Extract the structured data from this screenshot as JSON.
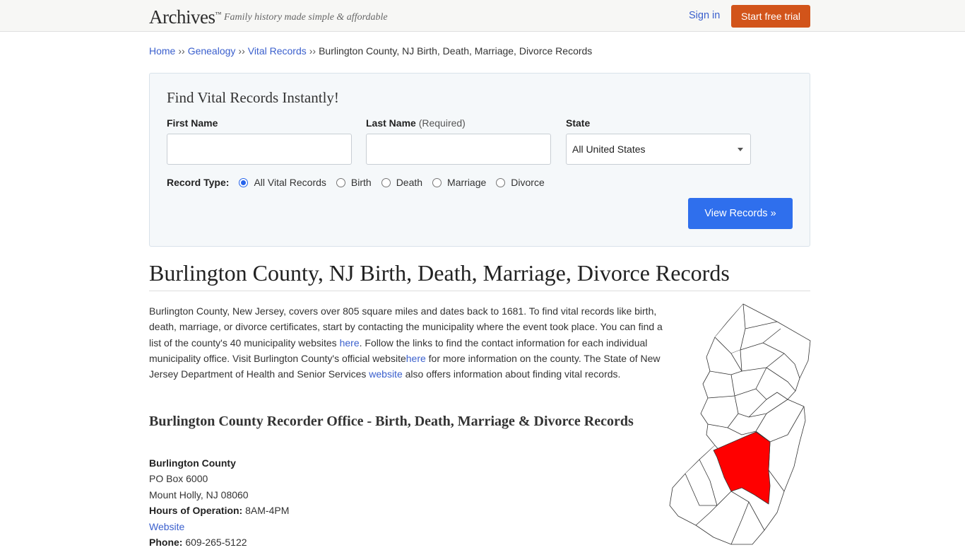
{
  "header": {
    "logo": "Archives",
    "logo_tm": "™",
    "tagline": "Family history made simple & affordable",
    "sign_in": "Sign in",
    "start_trial": "Start free trial"
  },
  "breadcrumb": {
    "items": [
      "Home",
      "Genealogy",
      "Vital Records"
    ],
    "separator": "››",
    "current": "Burlington County, NJ Birth, Death, Marriage, Divorce Records"
  },
  "search": {
    "title": "Find Vital Records Instantly!",
    "first_name_label": "First Name",
    "last_name_label": "Last Name",
    "last_name_required": "(Required)",
    "state_label": "State",
    "first_name_value": "",
    "last_name_value": "",
    "state_value": "All United States",
    "record_type_label": "Record Type:",
    "record_types": [
      "All Vital Records",
      "Birth",
      "Death",
      "Marriage",
      "Divorce"
    ],
    "selected_record_type": "All Vital Records",
    "submit": "View Records »"
  },
  "page_title": "Burlington County, NJ Birth, Death, Marriage, Divorce Records",
  "intro": {
    "p1": "Burlington County, New Jersey, covers over 805 square miles and dates back to 1681. To find vital records like birth, death, marriage, or divorce certificates, start by contacting the municipality where the event took place. You can find a list of the county's 40 municipality websites ",
    "link1": "here",
    "p2": ". Follow the links to find the contact information for each individual municipality office. Visit Burlington County's official website",
    "link2": "here",
    "p3": " for more information on the county. The State of New Jersey Department of Health and Senior Services ",
    "link3": "website",
    "p4": " also offers information about finding vital records."
  },
  "office_heading": "Burlington County Recorder Office - Birth, Death, Marriage & Divorce Records",
  "office": {
    "name": "Burlington County",
    "address1": "PO Box 6000",
    "address2": "Mount Holly, NJ 08060",
    "hours_label": "Hours of Operation:",
    "hours": "8AM-4PM",
    "website": "Website",
    "phone_label": "Phone:",
    "phone": "609-265-5122"
  },
  "colors": {
    "link": "#3a5fcd",
    "trial_button": "#d2541a",
    "view_button": "#2f6fed",
    "highlight_county": "#ff0000"
  }
}
